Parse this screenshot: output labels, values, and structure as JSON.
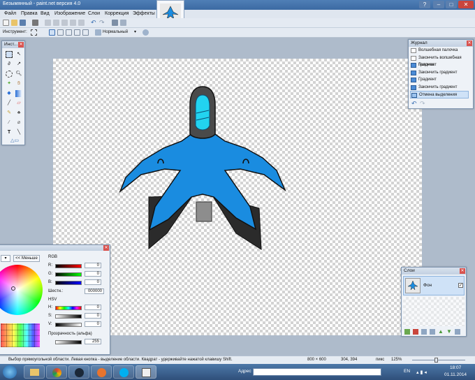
{
  "window": {
    "title": "Безымянный - paint.net версия 4.0"
  },
  "menu": [
    "Файл",
    "Правка",
    "Вид",
    "Изображение",
    "Слои",
    "Коррекция",
    "Эффекты"
  ],
  "toolbar": {
    "tool_label": "Инструмент:",
    "blend_mode": "Нормальный"
  },
  "tools_panel": {
    "title": "Инст..."
  },
  "history_panel": {
    "title": "Журнал",
    "items": [
      "Волшебная палочка",
      "Закончить волшебная палочка",
      "Градиент",
      "Закончить градиент",
      "Градиент",
      "Закончить градиент",
      "Отмена выделения"
    ]
  },
  "layers_panel": {
    "title": "Слои",
    "layer_name": "Фон"
  },
  "colors_panel": {
    "less_button": "<< Меньше",
    "rgb_label": "RGB",
    "r_label": "R:",
    "g_label": "G:",
    "b_label": "B:",
    "r_value": "0",
    "g_value": "0",
    "b_value": "0",
    "hex_label": "Шестн.:",
    "hex_value": "000000",
    "hsv_label": "HSV",
    "h_label": "H:",
    "s_label": "S:",
    "v_label": "V:",
    "h_value": "0",
    "s_value": "0",
    "v_value": "0",
    "alpha_label": "Прозрачность (альфа)",
    "alpha_value": "255"
  },
  "statusbar": {
    "hint": "Выбор прямоугольной области. Левая кнопка - выделение области. Квадрат - удерживайте нажатой клавишу Shift.",
    "size": "800 × 600",
    "coords": "304, 394",
    "units": "пикс",
    "zoom": "125%"
  },
  "taskbar": {
    "address_label": "Адрес",
    "lang": "EN",
    "time": "18:07",
    "date": "01.11.2014"
  },
  "colors": {
    "ship_blue": "#1a8ce0",
    "ship_dark": "#4a4a4a",
    "cockpit": "#22d3f0"
  }
}
